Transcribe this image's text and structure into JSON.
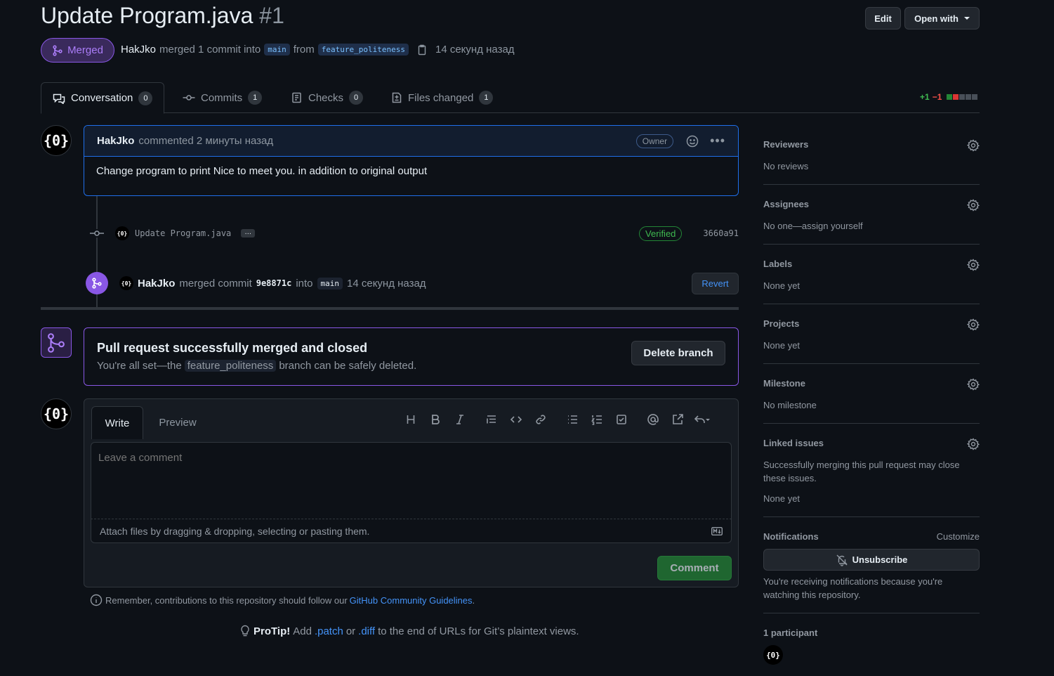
{
  "header": {
    "title": "Update Program.java",
    "number": "#1",
    "edit_label": "Edit",
    "open_with_label": "Open with"
  },
  "status": {
    "badge": "Merged",
    "author": "HakJko",
    "merged_text": "merged 1 commit into",
    "base_branch": "main",
    "from_text": "from",
    "head_branch": "feature_politeness",
    "time": "14 секунд назад"
  },
  "tabs": [
    {
      "label": "Conversation",
      "count": "0"
    },
    {
      "label": "Commits",
      "count": "1"
    },
    {
      "label": "Checks",
      "count": "0"
    },
    {
      "label": "Files changed",
      "count": "1"
    }
  ],
  "diffstat": {
    "additions": "+1",
    "deletions": "−1"
  },
  "comment": {
    "avatar_text": "{0}",
    "author": "HakJko",
    "action": "commented 2 минуты назад",
    "role": "Owner",
    "body": "Change program to print Nice to meet you. in addition to original output"
  },
  "commit": {
    "message": "Update Program.java",
    "ellipsis": "…",
    "verified": "Verified",
    "sha": "3660a91"
  },
  "merge_event": {
    "author": "HakJko",
    "text1": "merged commit",
    "sha": "9e8871c",
    "text2": "into",
    "branch": "main",
    "time": "14 секунд назад",
    "revert_label": "Revert"
  },
  "merged_box": {
    "title": "Pull request successfully merged and closed",
    "subtitle_prefix": "You're all set—the",
    "branch": "feature_politeness",
    "subtitle_suffix": "branch can be safely deleted.",
    "delete_label": "Delete branch"
  },
  "editor": {
    "write_tab": "Write",
    "preview_tab": "Preview",
    "placeholder": "Leave a comment",
    "attach_text": "Attach files by dragging & dropping, selecting or pasting them.",
    "comment_label": "Comment"
  },
  "footer": {
    "guidelines_text": "Remember, contributions to this repository should follow our",
    "guidelines_link": "GitHub Community Guidelines",
    "guidelines_end": ".",
    "protip_label": "ProTip!",
    "protip_1": "Add",
    "protip_patch": ".patch",
    "protip_or": "or",
    "protip_diff": ".diff",
    "protip_2": "to the end of URLs for Git’s plaintext views."
  },
  "sidebar": {
    "reviewers": {
      "title": "Reviewers",
      "value": "No reviews"
    },
    "assignees": {
      "title": "Assignees",
      "value": "No one—assign yourself"
    },
    "labels": {
      "title": "Labels",
      "value": "None yet"
    },
    "projects": {
      "title": "Projects",
      "value": "None yet"
    },
    "milestone": {
      "title": "Milestone",
      "value": "No milestone"
    },
    "linked_issues": {
      "title": "Linked issues",
      "desc": "Successfully merging this pull request may close these issues.",
      "value": "None yet"
    },
    "notifications": {
      "title": "Notifications",
      "customize": "Customize",
      "unsubscribe": "Unsubscribe",
      "desc": "You're receiving notifications because you're watching this repository."
    },
    "participants": {
      "title": "1 participant",
      "avatar_text": "{0}"
    }
  },
  "colors": {
    "merged_purple": "#8957e5",
    "accent_blue": "#4493f8",
    "success_green": "#238636",
    "danger_red": "#da3633"
  }
}
